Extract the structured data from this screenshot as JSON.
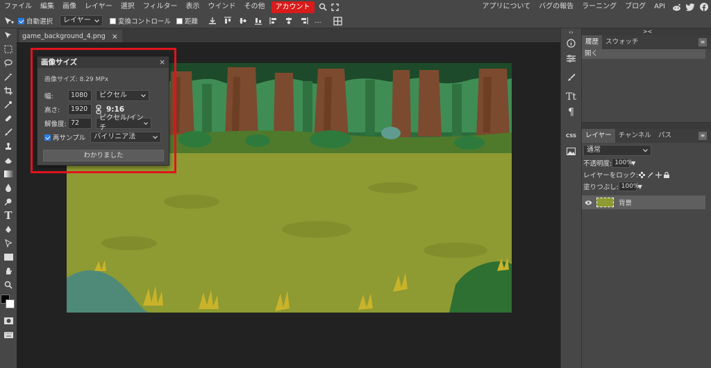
{
  "menu": {
    "items": [
      "ファイル",
      "編集",
      "画像",
      "レイヤー",
      "選択",
      "フィルター",
      "表示",
      "ウインド",
      "その他"
    ],
    "account": "アカウント",
    "right_links": [
      "アプリについて",
      "バグの報告",
      "ラーニング",
      "ブログ",
      "API"
    ]
  },
  "options": {
    "auto_select": "自動選択",
    "layer_select": "レイヤー",
    "transform_controls": "変換コントロール",
    "distance": "距離",
    "more": "..."
  },
  "document": {
    "tab_name": "game_background_4.png",
    "close": "×"
  },
  "dialog": {
    "title": "画像サイズ",
    "close": "×",
    "image_size": "画像サイズ: 8.29 MPx",
    "width_label": "幅:",
    "width_value": "1080",
    "width_unit": "ピクセル",
    "height_label": "高さ:",
    "height_value": "1920",
    "ratio": "9:16",
    "resolution_label": "解像度:",
    "resolution_value": "72",
    "resolution_unit": "ピクセル/インチ",
    "resample_label": "再サンプル",
    "resample_method": "バイリニア法",
    "ok": "わかりました"
  },
  "history_panel": {
    "tabs": [
      "履歴",
      "スウォッチ"
    ],
    "entry": "開く"
  },
  "layers_panel": {
    "tabs": [
      "レイヤー",
      "チャンネル",
      "パス"
    ],
    "blend_mode": "通常",
    "opacity_label": "不透明度:",
    "opacity_value": "100%",
    "lock_label": "レイヤーをロック:",
    "fill_label": "塗りつぶし:",
    "fill_value": "100%",
    "layer_name": "背景"
  },
  "right_strip": {
    "css_label": "CSS",
    "type_label": "Tt",
    "para_label": "¶"
  },
  "colors": {
    "accent": "#d81b1b",
    "highlight": "#e0141c",
    "checkbox": "#2a7de1"
  }
}
